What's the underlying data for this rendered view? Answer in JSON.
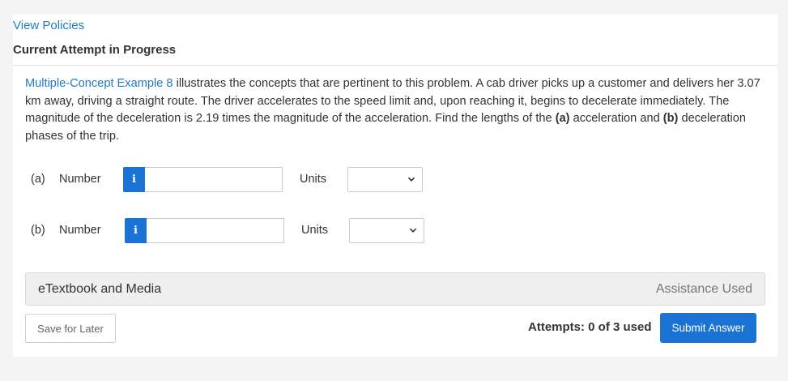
{
  "header": {
    "view_policies": "View Policies",
    "attempt_status": "Current Attempt in Progress"
  },
  "question": {
    "link_text": "Multiple-Concept Example 8",
    "text_1": " illustrates the concepts that are pertinent to this problem. A cab driver picks up a customer and delivers her 3.07 km away, driving a straight route. The driver accelerates to the speed limit and, upon reaching it, begins to decelerate immediately. The magnitude of the deceleration is 2.19 times the magnitude of the acceleration. Find the lengths of the ",
    "part_a_bold": "(a)",
    "text_2": " acceleration and ",
    "part_b_bold": "(b)",
    "text_3": " deceleration phases of the trip."
  },
  "answers": [
    {
      "part": "(a)",
      "number_label": "Number",
      "info_icon": "i",
      "value": "",
      "units_label": "Units",
      "units_selected": ""
    },
    {
      "part": "(b)",
      "number_label": "Number",
      "info_icon": "i",
      "value": "",
      "units_label": "Units",
      "units_selected": ""
    }
  ],
  "etextbook": {
    "label": "eTextbook and Media",
    "assistance": "Assistance Used"
  },
  "footer": {
    "save_label": "Save for Later",
    "attempts": "Attempts: 0 of 3 used",
    "submit_label": "Submit Answer"
  },
  "colors": {
    "accent": "#1a73d4",
    "link": "#1f7ac9",
    "background": "#f4f4f4"
  }
}
